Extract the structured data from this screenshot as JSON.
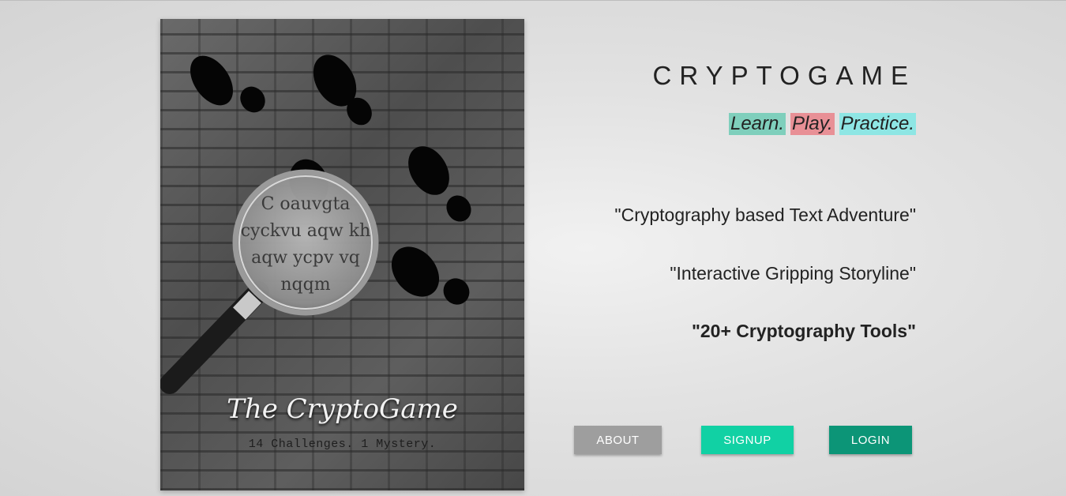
{
  "cover": {
    "title": "The CryptoGame",
    "subtitle": "14 Challenges. 1 Mystery.",
    "lens_lines": [
      "C oauvgta",
      "cyckvu aqw kh",
      "aqw ycpv vq",
      "nqqm"
    ]
  },
  "header": {
    "brand": "CRYPTOGAME",
    "tagline": {
      "learn": "Learn",
      "play": "Play",
      "practice": "Practice",
      "sep": "."
    }
  },
  "features": [
    "\"Cryptography based Text Adventure\"",
    "\"Interactive Gripping Storyline\"",
    "\"20+ Cryptography Tools\""
  ],
  "buttons": {
    "about": "ABOUT",
    "signup": "SIGNUP",
    "login": "LOGIN"
  },
  "colors": {
    "learn_highlight": "#7fcfbc",
    "play_highlight": "#e89096",
    "practice_highlight": "#8ee6e4",
    "about_button": "#9e9e9e",
    "signup_button": "#11d1a4",
    "login_button": "#0c9577"
  }
}
